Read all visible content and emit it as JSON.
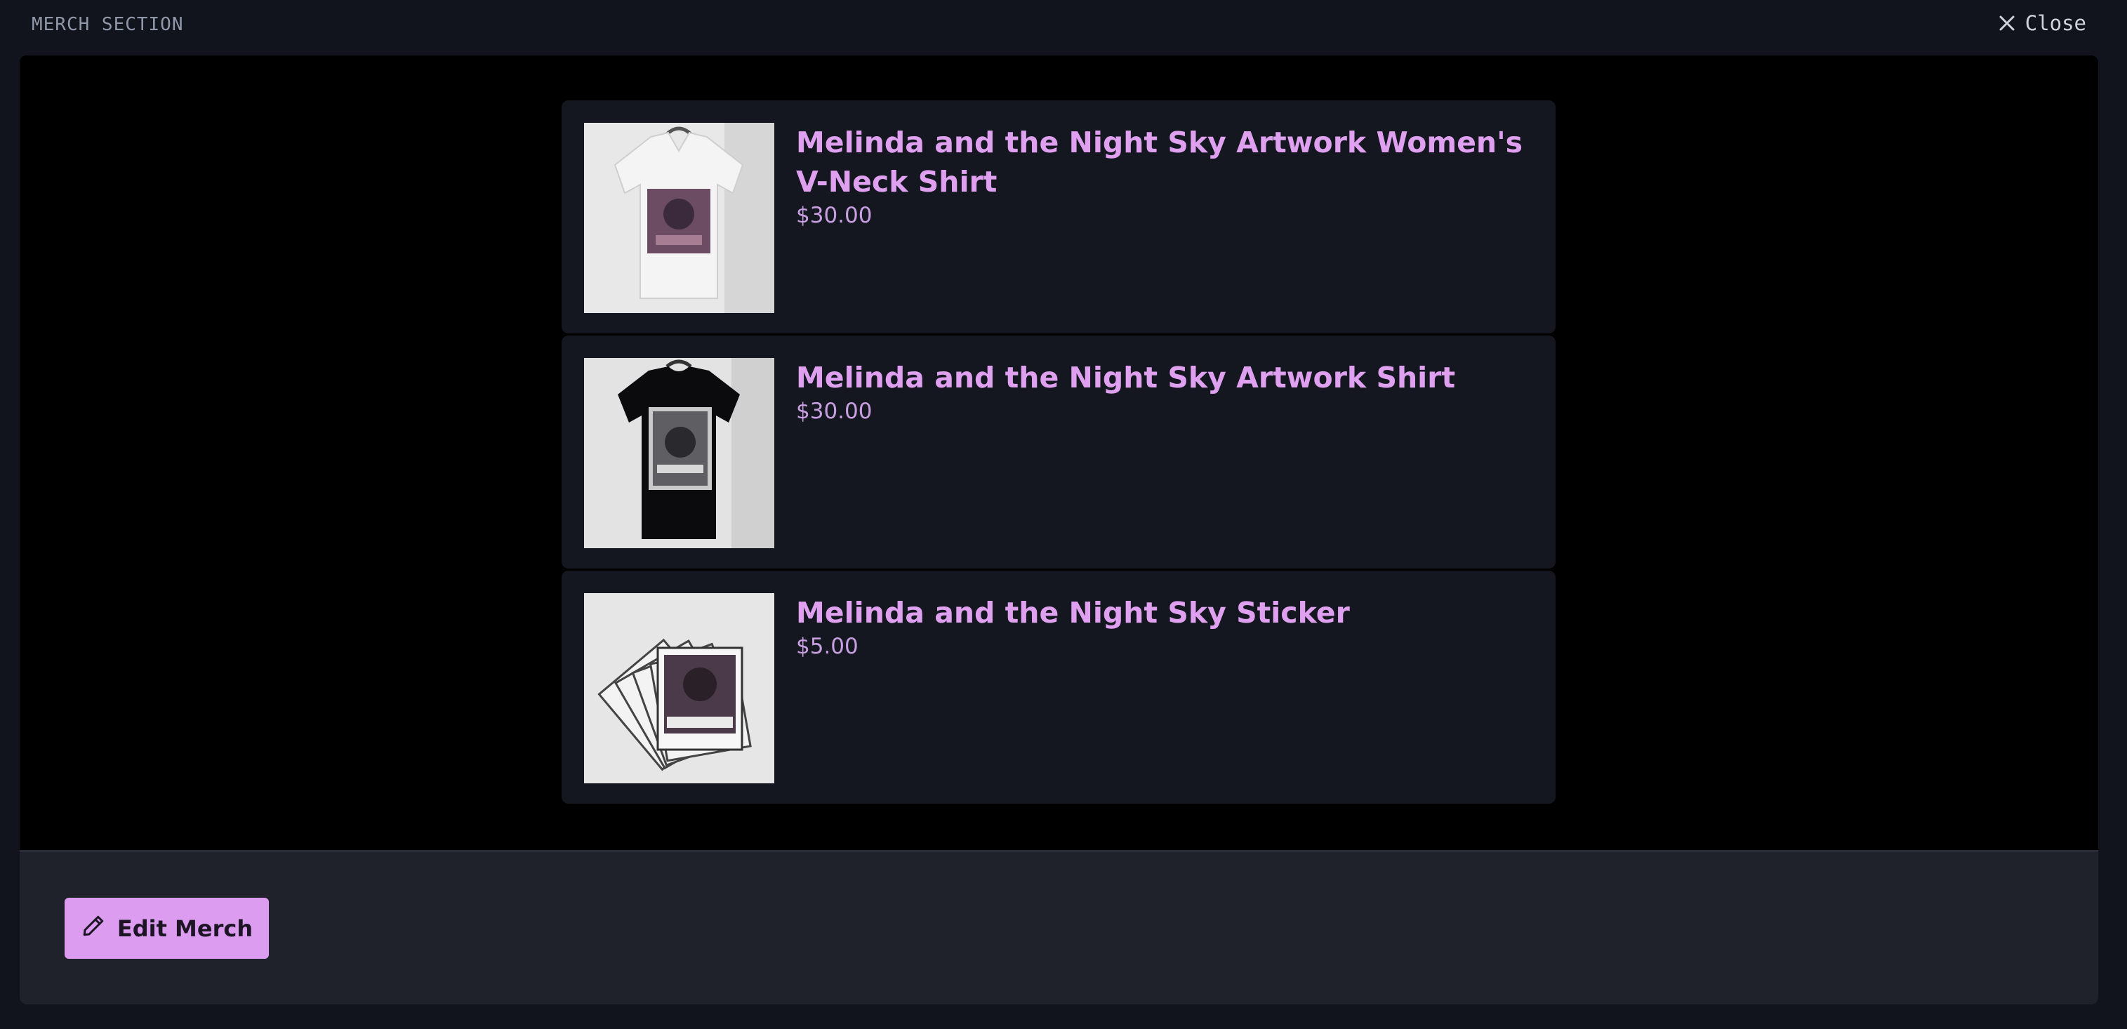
{
  "header": {
    "section_title": "MERCH SECTION",
    "close_label": "Close"
  },
  "merch": {
    "items": [
      {
        "title": "Melinda and the Night Sky Artwork Women's V-Neck Shirt",
        "price": "$30.00",
        "image": "white-vneck-shirt-photo"
      },
      {
        "title": "Melinda and the Night Sky Artwork Shirt",
        "price": "$30.00",
        "image": "black-tshirt-photo"
      },
      {
        "title": "Melinda and the Night Sky Sticker",
        "price": "$5.00",
        "image": "sticker-stack-photo"
      }
    ]
  },
  "footer": {
    "edit_label": "Edit Merch",
    "edit_icon": "pencil-icon"
  },
  "colors": {
    "accent": "#dc9cf0",
    "title_text": "#dfa0ef",
    "price_text": "#c89fe0",
    "card_bg": "#141720",
    "page_bg": "#11141c"
  }
}
